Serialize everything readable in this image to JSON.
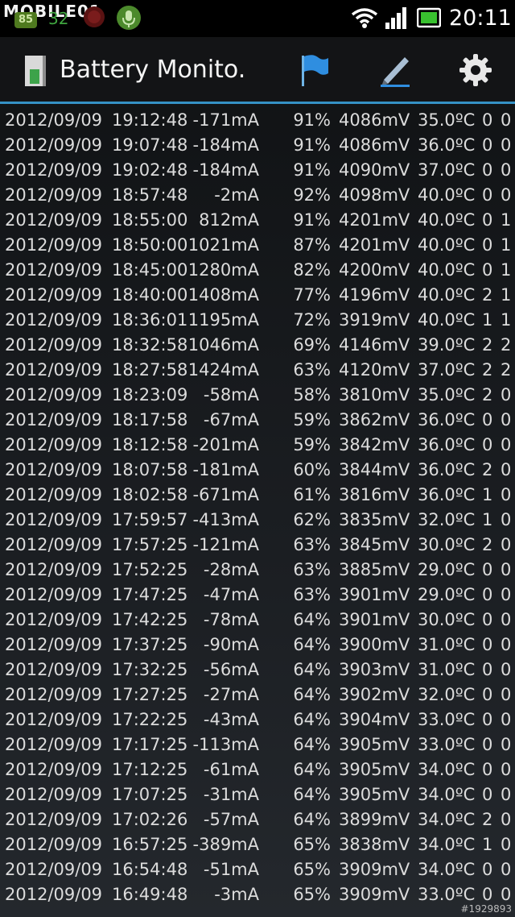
{
  "status_bar": {
    "watermark": "MOBILE01",
    "badge": "85",
    "count": "32",
    "time": "20:11",
    "icons": [
      "notification-icon",
      "mic-icon",
      "wifi-icon",
      "signal-icon",
      "battery-icon"
    ]
  },
  "action_bar": {
    "title": "Battery Monito.",
    "accent": "#3592c5",
    "actions": [
      "flag-icon",
      "edit-icon",
      "settings-gear-icon"
    ]
  },
  "log_rows": [
    [
      "2012/09/09",
      "19:12:48",
      "-171mA",
      "91%",
      "4086mV",
      "35.0ºC",
      "0",
      "0"
    ],
    [
      "2012/09/09",
      "19:07:48",
      "-184mA",
      "91%",
      "4086mV",
      "36.0ºC",
      "0",
      "0"
    ],
    [
      "2012/09/09",
      "19:02:48",
      "-184mA",
      "91%",
      "4090mV",
      "37.0ºC",
      "0",
      "0"
    ],
    [
      "2012/09/09",
      "18:57:48",
      "-2mA",
      "92%",
      "4098mV",
      "40.0ºC",
      "0",
      "0"
    ],
    [
      "2012/09/09",
      "18:55:00",
      "812mA",
      "91%",
      "4201mV",
      "40.0ºC",
      "0",
      "1"
    ],
    [
      "2012/09/09",
      "18:50:00",
      "1021mA",
      "87%",
      "4201mV",
      "40.0ºC",
      "0",
      "1"
    ],
    [
      "2012/09/09",
      "18:45:00",
      "1280mA",
      "82%",
      "4200mV",
      "40.0ºC",
      "0",
      "1"
    ],
    [
      "2012/09/09",
      "18:40:00",
      "1408mA",
      "77%",
      "4196mV",
      "40.0ºC",
      "2",
      "1"
    ],
    [
      "2012/09/09",
      "18:36:01",
      "1195mA",
      "72%",
      "3919mV",
      "40.0ºC",
      "1",
      "1"
    ],
    [
      "2012/09/09",
      "18:32:58",
      "1046mA",
      "69%",
      "4146mV",
      "39.0ºC",
      "2",
      "2"
    ],
    [
      "2012/09/09",
      "18:27:58",
      "1424mA",
      "63%",
      "4120mV",
      "37.0ºC",
      "2",
      "2"
    ],
    [
      "2012/09/09",
      "18:23:09",
      "-58mA",
      "58%",
      "3810mV",
      "35.0ºC",
      "2",
      "0"
    ],
    [
      "2012/09/09",
      "18:17:58",
      "-67mA",
      "59%",
      "3862mV",
      "36.0ºC",
      "0",
      "0"
    ],
    [
      "2012/09/09",
      "18:12:58",
      "-201mA",
      "59%",
      "3842mV",
      "36.0ºC",
      "0",
      "0"
    ],
    [
      "2012/09/09",
      "18:07:58",
      "-181mA",
      "60%",
      "3844mV",
      "36.0ºC",
      "2",
      "0"
    ],
    [
      "2012/09/09",
      "18:02:58",
      "-671mA",
      "61%",
      "3816mV",
      "36.0ºC",
      "1",
      "0"
    ],
    [
      "2012/09/09",
      "17:59:57",
      "-413mA",
      "62%",
      "3835mV",
      "32.0ºC",
      "1",
      "0"
    ],
    [
      "2012/09/09",
      "17:57:25",
      "-121mA",
      "63%",
      "3845mV",
      "30.0ºC",
      "2",
      "0"
    ],
    [
      "2012/09/09",
      "17:52:25",
      "-28mA",
      "63%",
      "3885mV",
      "29.0ºC",
      "0",
      "0"
    ],
    [
      "2012/09/09",
      "17:47:25",
      "-47mA",
      "63%",
      "3901mV",
      "29.0ºC",
      "0",
      "0"
    ],
    [
      "2012/09/09",
      "17:42:25",
      "-78mA",
      "64%",
      "3901mV",
      "30.0ºC",
      "0",
      "0"
    ],
    [
      "2012/09/09",
      "17:37:25",
      "-90mA",
      "64%",
      "3900mV",
      "31.0ºC",
      "0",
      "0"
    ],
    [
      "2012/09/09",
      "17:32:25",
      "-56mA",
      "64%",
      "3903mV",
      "31.0ºC",
      "0",
      "0"
    ],
    [
      "2012/09/09",
      "17:27:25",
      "-27mA",
      "64%",
      "3902mV",
      "32.0ºC",
      "0",
      "0"
    ],
    [
      "2012/09/09",
      "17:22:25",
      "-43mA",
      "64%",
      "3904mV",
      "33.0ºC",
      "0",
      "0"
    ],
    [
      "2012/09/09",
      "17:17:25",
      "-113mA",
      "64%",
      "3905mV",
      "33.0ºC",
      "0",
      "0"
    ],
    [
      "2012/09/09",
      "17:12:25",
      "-61mA",
      "64%",
      "3905mV",
      "34.0ºC",
      "0",
      "0"
    ],
    [
      "2012/09/09",
      "17:07:25",
      "-31mA",
      "64%",
      "3905mV",
      "34.0ºC",
      "0",
      "0"
    ],
    [
      "2012/09/09",
      "17:02:26",
      "-57mA",
      "64%",
      "3899mV",
      "34.0ºC",
      "2",
      "0"
    ],
    [
      "2012/09/09",
      "16:57:25",
      "-389mA",
      "65%",
      "3838mV",
      "34.0ºC",
      "1",
      "0"
    ],
    [
      "2012/09/09",
      "16:54:48",
      "-51mA",
      "65%",
      "3909mV",
      "34.0ºC",
      "0",
      "0"
    ],
    [
      "2012/09/09",
      "16:49:48",
      "-3mA",
      "65%",
      "3909mV",
      "33.0ºC",
      "0",
      "0"
    ]
  ],
  "credit": "#1929893"
}
